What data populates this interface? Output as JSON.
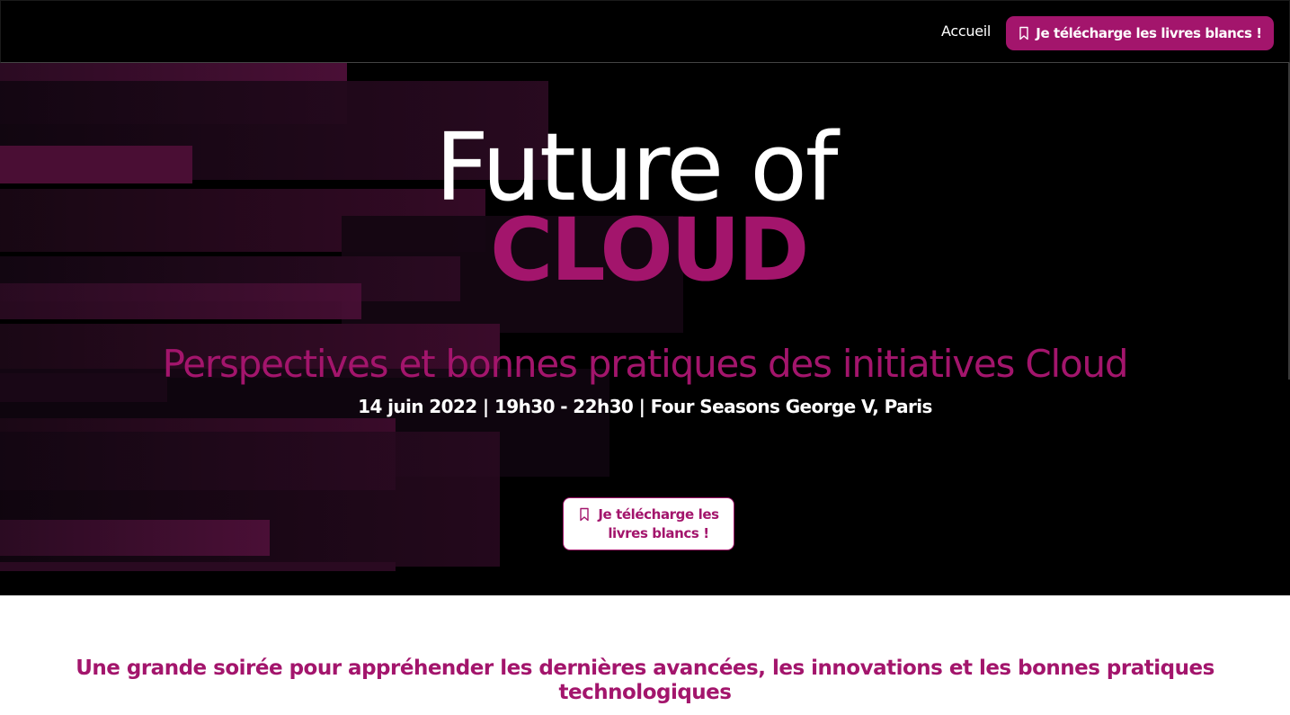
{
  "nav": {
    "home_label": "Accueil",
    "cta_label": "Je télécharge les livres blancs !",
    "cta_icon": "bookmark-icon"
  },
  "hero": {
    "title_line1": "Future of",
    "title_line2": "CLOUD",
    "subtitle": "Perspectives et bonnes pratiques des initiatives Cloud",
    "event_info": "14 juin 2022 | 19h30 - 22h30 | Four Seasons George V, Paris",
    "cta_label": "Je télécharge les livres blancs !",
    "cta_icon": "bookmark-icon"
  },
  "intro": {
    "tagline": "Une grande soirée pour appréhender les dernières avancées, les innovations et les bonnes pratiques technologiques"
  },
  "colors": {
    "brand": "#a3156c",
    "background_dark": "#000000",
    "text_light": "#ffffff"
  }
}
